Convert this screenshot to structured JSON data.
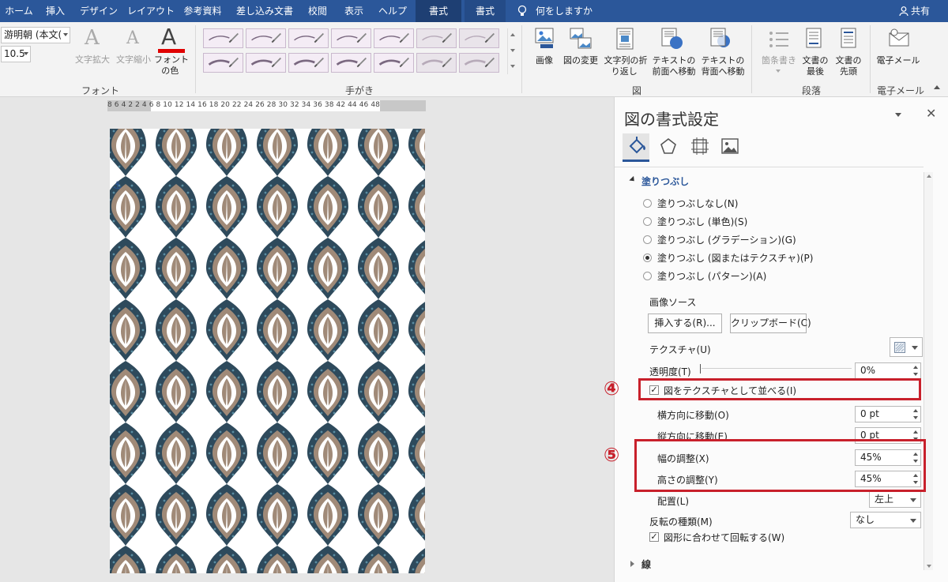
{
  "tabs": [
    "ホーム",
    "挿入",
    "デザイン",
    "レイアウト",
    "参考資料",
    "差し込み文書",
    "校閲",
    "表示",
    "ヘルプ",
    "書式",
    "書式"
  ],
  "tell_me": "何をしますか",
  "share": "共有",
  "ribbon": {
    "font_name": "游明朝 (本文(",
    "font_size": "10.5",
    "grow_font": "文字拡大",
    "shrink_font": "文字縮小",
    "font_color": "フォント\nの色 ",
    "font_group": "フォント",
    "pens_group": "手がき",
    "picture": "画像",
    "change_picture": "図の変更",
    "wrap_text": "文字列の折\nり返し ",
    "bring_forward": "テキストの\n前面へ移動",
    "send_backward": "テキストの\n背面へ移動",
    "picture_group": "図",
    "bullets": "箇条書き",
    "move_to_end": "文書の\n最後",
    "move_to_start": "文書の\n先頭",
    "paragraph_group": "段落",
    "e_mail": "電子メール",
    "email_group": "電子メール"
  },
  "ruler_text": "8 6 4 2    2 4 6 8 10 12 14 16 18 20 22 24 26 28 30 32 34 36 38    42 44 46 48",
  "pane": {
    "title": "図の書式設定",
    "fill_section": "塗りつぶし",
    "fill_options": [
      {
        "label": "塗りつぶしなし(N)",
        "selected": false
      },
      {
        "label": "塗りつぶし (単色)(S)",
        "selected": false
      },
      {
        "label": "塗りつぶし (グラデーション)(G)",
        "selected": false
      },
      {
        "label": "塗りつぶし (図またはテクスチャ)(P)",
        "selected": true
      },
      {
        "label": "塗りつぶし (パターン)(A)",
        "selected": false
      }
    ],
    "picture_source": "画像ソース",
    "insert_button": "挿入する(R)...",
    "clipboard_button": "クリップボード(C)",
    "texture_label": "テクスチャ(U)",
    "transparency_label": "透明度(T)",
    "transparency_value": "0%",
    "tile_label": "図をテクスチャとして並べる(I)",
    "tile_checked": true,
    "offset_x_label": "横方向に移動(O)",
    "offset_x_value": "0 pt",
    "offset_y_label": "縦方向に移動(E)",
    "offset_y_value": "0 pt",
    "scale_x_label": "幅の調整(X)",
    "scale_x_value": "45%",
    "scale_y_label": "高さの調整(Y)",
    "scale_y_value": "45%",
    "alignment_label": "配置(L)",
    "alignment_value": "左上",
    "mirror_label": "反転の種類(M)",
    "mirror_value": "なし",
    "rotate_label": "図形に合わせて回転する(W)",
    "rotate_checked": true,
    "line_section": "線"
  },
  "annotations": {
    "marker4": "④",
    "marker5": "⑤"
  },
  "colors": {
    "title_bar": "#2b579a",
    "highlight": "#c8202b",
    "pattern_navy": "#2e4a5c",
    "pattern_tan": "#a08a78",
    "pattern_dot": "#5a8ea3"
  }
}
